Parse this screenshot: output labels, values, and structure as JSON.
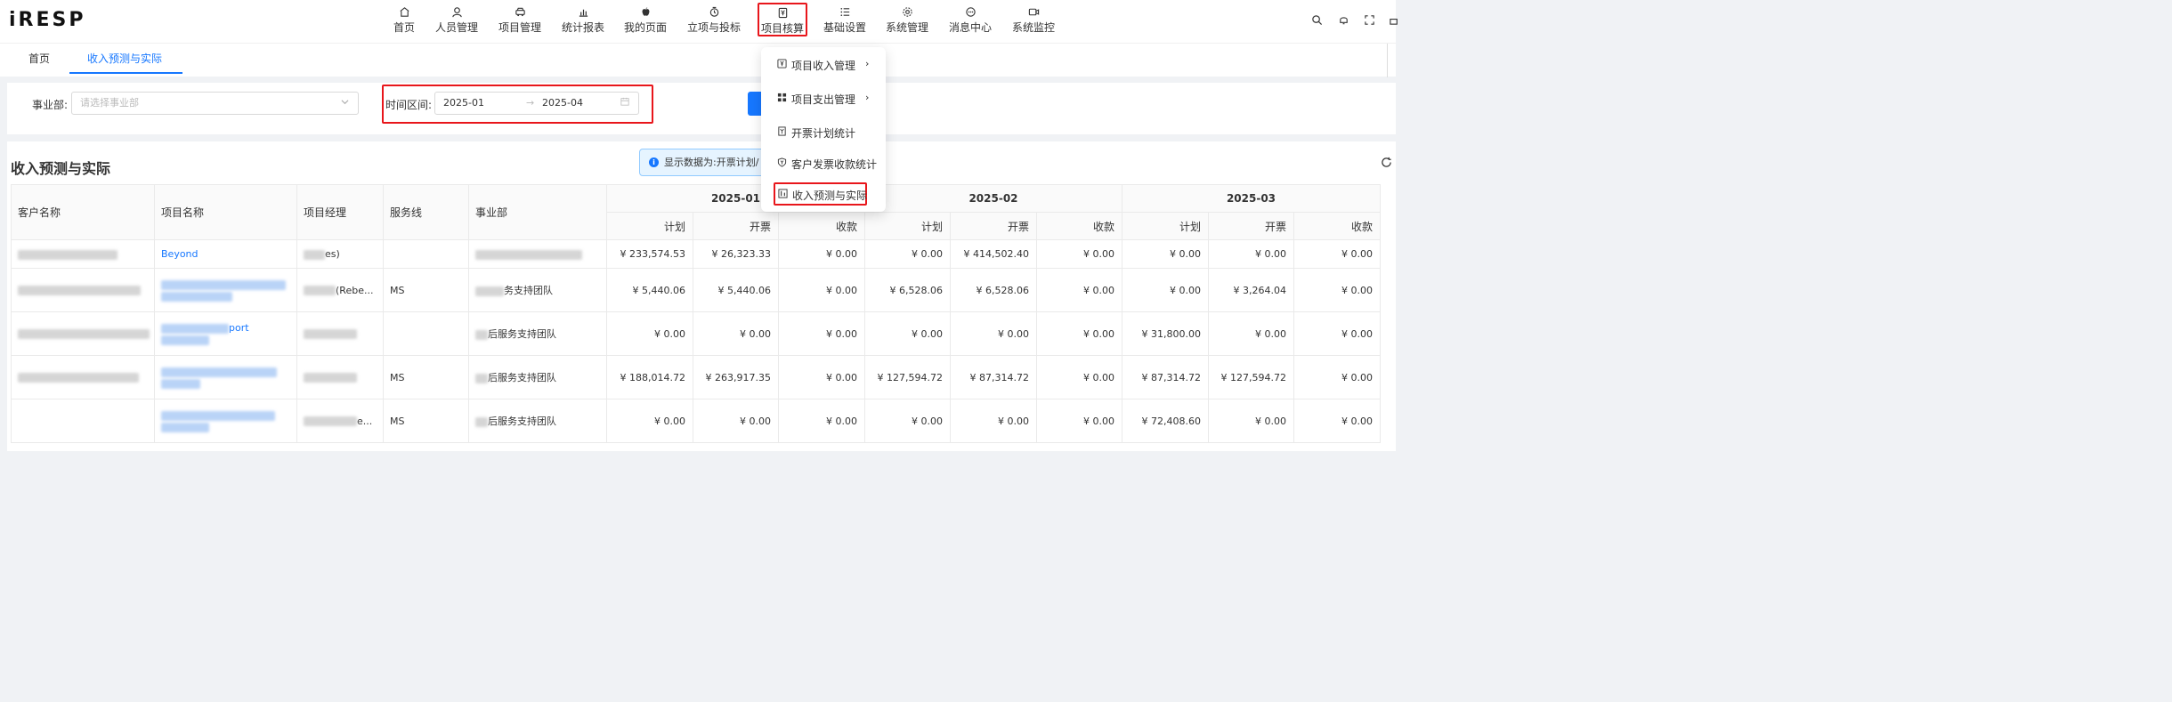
{
  "brand": {
    "logo": "iRESP"
  },
  "nav": [
    {
      "label": "首页",
      "icon": "home-icon"
    },
    {
      "label": "人员管理",
      "icon": "user-icon"
    },
    {
      "label": "项目管理",
      "icon": "car-icon"
    },
    {
      "label": "统计报表",
      "icon": "bar-chart-icon"
    },
    {
      "label": "我的页面",
      "icon": "apple-icon"
    },
    {
      "label": "立项与投标",
      "icon": "timer-icon"
    },
    {
      "label": "项目核算",
      "icon": "accounting-icon"
    },
    {
      "label": "基础设置",
      "icon": "list-icon"
    },
    {
      "label": "系统管理",
      "icon": "gear-icon"
    },
    {
      "label": "消息中心",
      "icon": "message-icon"
    },
    {
      "label": "系统监控",
      "icon": "video-icon"
    }
  ],
  "tabs": [
    {
      "label": "首页"
    },
    {
      "label": "收入预测与实际"
    }
  ],
  "filter": {
    "dept_label": "事业部:",
    "dept_placeholder": "请选择事业部",
    "time_label": "时间区间:",
    "time_start": "2025-01",
    "time_end": "2025-04",
    "range_arrow": "→"
  },
  "card": {
    "title": "收入预测与实际",
    "notice": "显示数据为:开票计划/"
  },
  "dropdown": [
    {
      "label": "项目收入管理",
      "icon": "yen-doc-icon",
      "arrow": "›"
    },
    {
      "label": "项目支出管理",
      "icon": "grid-icon",
      "arrow": "›"
    },
    {
      "label": "开票计划统计",
      "icon": "invoice-icon",
      "arrow": ""
    },
    {
      "label": "客户发票收款统计",
      "icon": "shield-yen-icon",
      "arrow": ""
    },
    {
      "label": "收入预测与实际",
      "icon": "compare-icon",
      "arrow": ""
    }
  ],
  "table": {
    "headers": {
      "customer": "客户名称",
      "project": "项目名称",
      "manager": "项目经理",
      "service": "服务线",
      "dept": "事业部"
    },
    "months": [
      "2025-01",
      "2025-02",
      "2025-03"
    ],
    "sub_headers": {
      "plan": "计划",
      "invoice": "开票",
      "receipt": "收款"
    },
    "rows": [
      {
        "project_text": "Beyond",
        "manager_text": "es)",
        "service": "",
        "dept_text": "",
        "vals": [
          "¥ 233,574.53",
          "¥ 26,323.33",
          "¥ 0.00",
          "¥ 0.00",
          "¥ 414,502.40",
          "¥ 0.00",
          "¥ 0.00",
          "¥ 0.00",
          "¥ 0.00"
        ]
      },
      {
        "project_text": "",
        "manager_text": "(Rebe...",
        "service": "MS",
        "dept_text": "务支持团队",
        "vals": [
          "¥ 5,440.06",
          "¥ 5,440.06",
          "¥ 0.00",
          "¥ 6,528.06",
          "¥ 6,528.06",
          "¥ 0.00",
          "¥ 0.00",
          "¥ 3,264.04",
          "¥ 0.00"
        ]
      },
      {
        "project_text": "port",
        "manager_text": "",
        "service": "",
        "dept_text": "后服务支持团队",
        "vals": [
          "¥ 0.00",
          "¥ 0.00",
          "¥ 0.00",
          "¥ 0.00",
          "¥ 0.00",
          "¥ 0.00",
          "¥ 31,800.00",
          "¥ 0.00",
          "¥ 0.00"
        ]
      },
      {
        "project_text": "",
        "manager_text": "",
        "service": "MS",
        "dept_text": "后服务支持团队",
        "vals": [
          "¥ 188,014.72",
          "¥ 263,917.35",
          "¥ 0.00",
          "¥ 127,594.72",
          "¥ 87,314.72",
          "¥ 0.00",
          "¥ 87,314.72",
          "¥ 127,594.72",
          "¥ 0.00"
        ]
      },
      {
        "project_text": "",
        "manager_text": "e...",
        "service": "MS",
        "dept_text": "后服务支持团队",
        "vals": [
          "¥ 0.00",
          "¥ 0.00",
          "¥ 0.00",
          "¥ 0.00",
          "¥ 0.00",
          "¥ 0.00",
          "¥ 72,408.60",
          "¥ 0.00",
          "¥ 0.00"
        ]
      }
    ]
  },
  "colors": {
    "accent": "#1677ff",
    "highlight": "#e8161b"
  }
}
